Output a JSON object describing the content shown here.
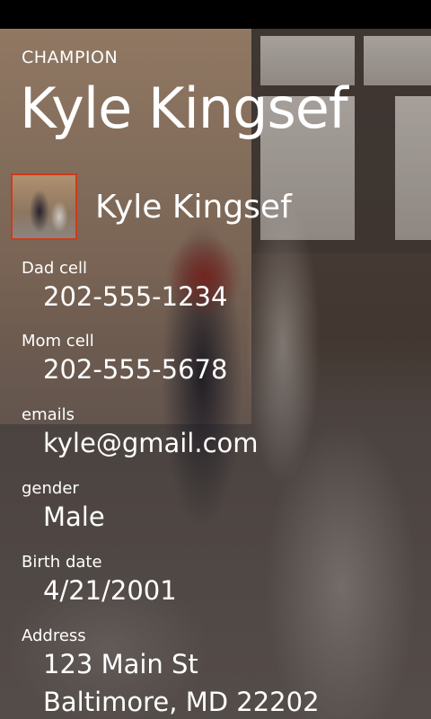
{
  "app": {
    "title": "CHAMPION"
  },
  "page": {
    "title": "Kyle Kingsef"
  },
  "profile": {
    "name": "Kyle Kingsef"
  },
  "fields": {
    "dad_cell": {
      "label": "Dad cell",
      "value": "202-555-1234"
    },
    "mom_cell": {
      "label": "Mom cell",
      "value": "202-555-5678"
    },
    "emails": {
      "label": "emails",
      "value": "kyle@gmail.com"
    },
    "gender": {
      "label": "gender",
      "value": "Male"
    },
    "birth_date": {
      "label": "Birth date",
      "value": "4/21/2001"
    },
    "address": {
      "label": "Address",
      "line1": "123 Main St",
      "line2": "Baltimore, MD 22202"
    }
  },
  "colors": {
    "accent": "#d03a1a"
  }
}
